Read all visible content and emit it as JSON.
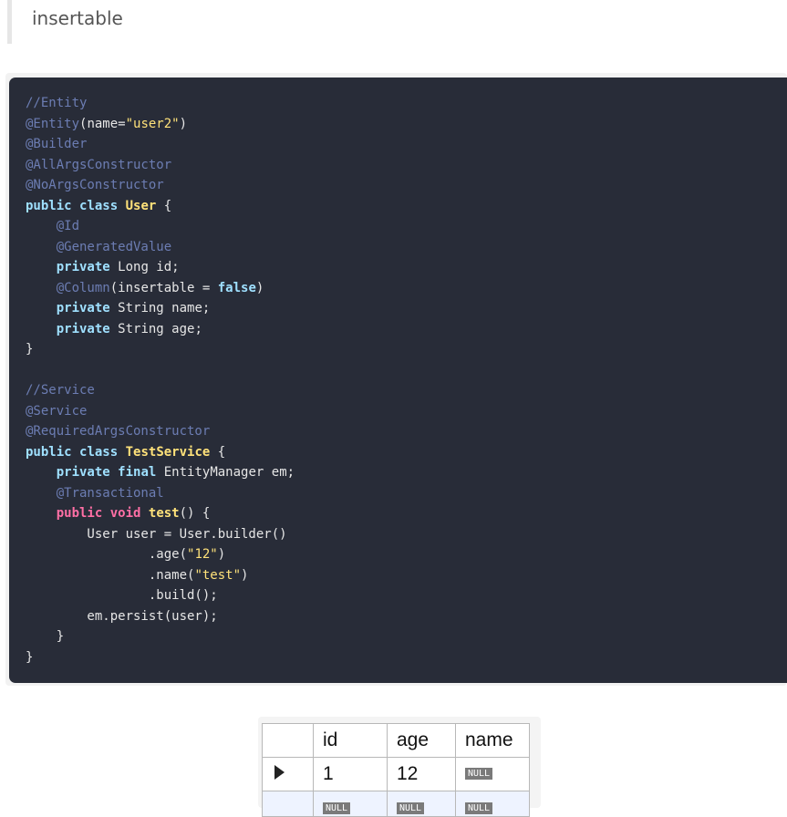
{
  "quote": {
    "text": "insertable"
  },
  "code": {
    "lines": [
      [
        [
          "t-comment",
          "//Entity"
        ]
      ],
      [
        [
          "t-annot",
          "@Entity"
        ],
        [
          "t-plain",
          "(name="
        ],
        [
          "t-str",
          "\"user2\""
        ],
        [
          "t-plain",
          ")"
        ]
      ],
      [
        [
          "t-annot",
          "@Builder"
        ]
      ],
      [
        [
          "t-annot",
          "@AllArgsConstructor"
        ]
      ],
      [
        [
          "t-annot",
          "@NoArgsConstructor"
        ]
      ],
      [
        [
          "t-kw",
          "public"
        ],
        [
          "t-plain",
          " "
        ],
        [
          "t-kw",
          "class"
        ],
        [
          "t-plain",
          " "
        ],
        [
          "t-type",
          "User"
        ],
        [
          "t-plain",
          " {"
        ]
      ],
      [
        [
          "t-plain",
          "    "
        ],
        [
          "t-annot",
          "@Id"
        ]
      ],
      [
        [
          "t-plain",
          "    "
        ],
        [
          "t-annot",
          "@GeneratedValue"
        ]
      ],
      [
        [
          "t-plain",
          "    "
        ],
        [
          "t-kw",
          "private"
        ],
        [
          "t-plain",
          " Long id;"
        ]
      ],
      [
        [
          "t-plain",
          "    "
        ],
        [
          "t-annot",
          "@Column"
        ],
        [
          "t-plain",
          "(insertable = "
        ],
        [
          "t-kw",
          "false"
        ],
        [
          "t-plain",
          ")"
        ]
      ],
      [
        [
          "t-plain",
          "    "
        ],
        [
          "t-kw",
          "private"
        ],
        [
          "t-plain",
          " String name;"
        ]
      ],
      [
        [
          "t-plain",
          "    "
        ],
        [
          "t-kw",
          "private"
        ],
        [
          "t-plain",
          " String age;"
        ]
      ],
      [
        [
          "t-plain",
          "}"
        ]
      ],
      [
        [
          "t-plain",
          ""
        ]
      ],
      [
        [
          "t-comment",
          "//Service"
        ]
      ],
      [
        [
          "t-annot",
          "@Service"
        ]
      ],
      [
        [
          "t-annot",
          "@RequiredArgsConstructor"
        ]
      ],
      [
        [
          "t-kw",
          "public"
        ],
        [
          "t-plain",
          " "
        ],
        [
          "t-kw",
          "class"
        ],
        [
          "t-plain",
          " "
        ],
        [
          "t-type",
          "TestService"
        ],
        [
          "t-plain",
          " {"
        ]
      ],
      [
        [
          "t-plain",
          "    "
        ],
        [
          "t-kw",
          "private"
        ],
        [
          "t-plain",
          " "
        ],
        [
          "t-kw",
          "final"
        ],
        [
          "t-plain",
          " EntityManager em;"
        ]
      ],
      [
        [
          "t-plain",
          "    "
        ],
        [
          "t-annot",
          "@Transactional"
        ]
      ],
      [
        [
          "t-plain",
          "    "
        ],
        [
          "t-kw2",
          "public"
        ],
        [
          "t-plain",
          " "
        ],
        [
          "t-kw2",
          "void"
        ],
        [
          "t-plain",
          " "
        ],
        [
          "t-fn",
          "test"
        ],
        [
          "t-plain",
          "() {"
        ]
      ],
      [
        [
          "t-plain",
          "        User user = User.builder()"
        ]
      ],
      [
        [
          "t-plain",
          "                .age("
        ],
        [
          "t-str",
          "\"12\""
        ],
        [
          "t-plain",
          ")"
        ]
      ],
      [
        [
          "t-plain",
          "                .name("
        ],
        [
          "t-str",
          "\"test\""
        ],
        [
          "t-plain",
          ")"
        ]
      ],
      [
        [
          "t-plain",
          "                .build();"
        ]
      ],
      [
        [
          "t-plain",
          "        em.persist(user);"
        ]
      ],
      [
        [
          "t-plain",
          "    }"
        ]
      ],
      [
        [
          "t-plain",
          "}"
        ]
      ]
    ]
  },
  "result_table": {
    "columns": [
      "id",
      "age",
      "name"
    ],
    "rows": [
      {
        "id": "1",
        "age": "12",
        "name": "NULL"
      },
      {
        "id": "NULL",
        "age": "NULL",
        "name": "NULL"
      }
    ]
  },
  "colors": {
    "code_bg": "#282c38",
    "keyword": "#9fe0ff",
    "method_keyword": "#ff6fa5",
    "type_string": "#ffe27a",
    "annotation_comment": "#6c7db3"
  }
}
